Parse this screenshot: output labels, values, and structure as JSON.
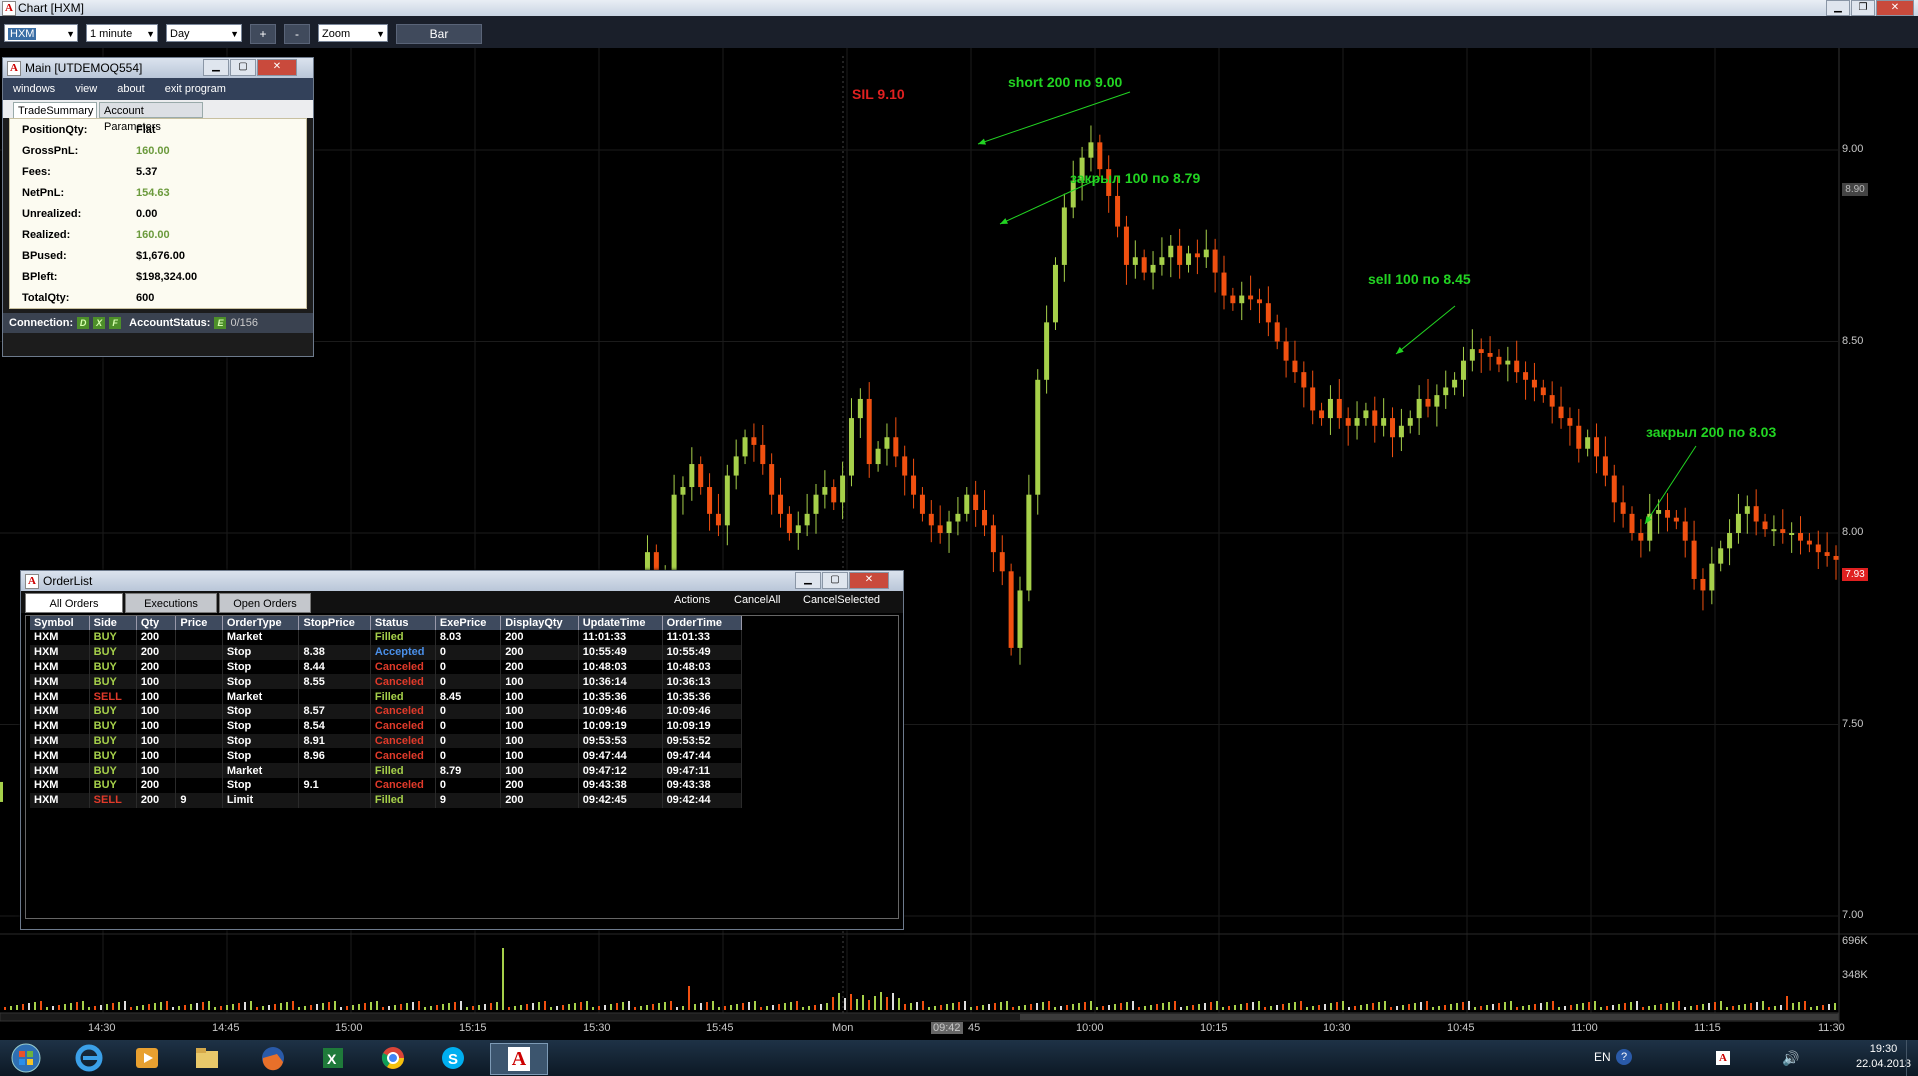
{
  "window": {
    "title": "Chart [HXM]"
  },
  "toolbar": {
    "symbol": "HXM",
    "interval": "1 minute",
    "period": "Day",
    "plus": "+",
    "minus": "-",
    "zoom": "Zoom",
    "style": "Bar"
  },
  "annotations": {
    "sl": "SIL 9.10",
    "short": "short 200  по 9.00",
    "close1": "закрыл 100 по 8.79",
    "sell": "sell 100 по 8.45",
    "close2": "закрыл 200 по 8.03"
  },
  "chart_data": {
    "type": "candlestick",
    "price_ticks": [
      "9.00",
      "8.50",
      "8.00",
      "7.50",
      "7.00"
    ],
    "volume_ticks": [
      "696K",
      "348K"
    ],
    "current_price_tags": [
      "8.90",
      "7.93"
    ],
    "time_labels": [
      "14:30",
      "14:45",
      "15:00",
      "15:15",
      "15:30",
      "15:45",
      "Mon",
      "09:42",
      "45",
      "10:00",
      "10:15",
      "10:30",
      "10:45",
      "11:00",
      "11:15",
      "11:30"
    ],
    "ylim": [
      6.98,
      9.3
    ],
    "close_path": [
      7.35,
      7.3,
      7.55,
      7.8,
      7.95,
      7.75,
      7.88,
      8.1,
      8.12,
      8.18,
      8.12,
      8.05,
      8.02,
      8.15,
      8.2,
      8.25,
      8.23,
      8.18,
      8.1,
      8.05,
      8.0,
      8.02,
      8.05,
      8.1,
      8.12,
      8.08,
      8.15,
      8.3,
      8.35,
      8.18,
      8.22,
      8.25,
      8.2,
      8.15,
      8.1,
      8.05,
      8.02,
      8.0,
      8.03,
      8.05,
      8.1,
      8.06,
      8.02,
      7.95,
      7.9,
      7.7,
      7.85,
      8.1,
      8.4,
      8.55,
      8.7,
      8.85,
      8.92,
      8.98,
      9.02,
      8.95,
      8.88,
      8.8,
      8.7,
      8.72,
      8.68,
      8.7,
      8.72,
      8.75,
      8.7,
      8.73,
      8.72,
      8.74,
      8.68,
      8.62,
      8.6,
      8.62,
      8.61,
      8.6,
      8.55,
      8.5,
      8.45,
      8.42,
      8.38,
      8.32,
      8.3,
      8.35,
      8.3,
      8.28,
      8.3,
      8.32,
      8.28,
      8.3,
      8.25,
      8.28,
      8.3,
      8.35,
      8.33,
      8.36,
      8.38,
      8.4,
      8.45,
      8.48,
      8.47,
      8.46,
      8.44,
      8.45,
      8.42,
      8.4,
      8.38,
      8.36,
      8.33,
      8.3,
      8.28,
      8.22,
      8.25,
      8.2,
      8.15,
      8.08,
      8.05,
      8.0,
      7.98,
      8.05,
      8.06,
      8.04,
      8.03,
      7.98,
      7.88,
      7.85,
      7.92,
      7.96,
      8.0,
      8.05,
      8.07,
      8.03,
      8.01,
      8.01,
      8.0,
      8.0,
      7.98,
      7.97,
      7.95,
      7.94,
      7.93
    ]
  },
  "main_window": {
    "title": "Main [UTDEMOQ554]",
    "menu": [
      "windows",
      "view",
      "about",
      "exit program"
    ],
    "tabs": [
      "TradeSummary",
      "Account Parameters"
    ],
    "summary": [
      {
        "k": "PositionQty:",
        "v": "Flat"
      },
      {
        "k": "GrossPnL:",
        "v": "160.00"
      },
      {
        "k": "Fees:",
        "v": "5.37"
      },
      {
        "k": "NetPnL:",
        "v": "154.63"
      },
      {
        "k": "Unrealized:",
        "v": "0.00"
      },
      {
        "k": "Realized:",
        "v": "160.00"
      },
      {
        "k": "BPused:",
        "v": "$1,676.00"
      },
      {
        "k": "BPleft:",
        "v": "$198,324.00"
      },
      {
        "k": "TotalQty:",
        "v": "600"
      }
    ],
    "status": {
      "connection": "Connection:",
      "d": "D",
      "x": "X",
      "f": "F",
      "account": "AccountStatus:",
      "e": "E",
      "count": "0/156"
    }
  },
  "orders_window": {
    "title": "OrderList",
    "tabs": [
      "All Orders",
      "Executions",
      "Open Orders"
    ],
    "actions": [
      "Actions",
      "CancelAll",
      "CancelSelected"
    ],
    "columns": [
      "Symbol",
      "Side",
      "Qty",
      "Price",
      "OrderType",
      "StopPrice",
      "Status",
      "ExePrice",
      "DisplayQty",
      "UpdateTime",
      "OrderTime"
    ],
    "rows": [
      [
        "HXM",
        "BUY",
        "200",
        "",
        "Market",
        "",
        "Filled",
        "8.03",
        "200",
        "11:01:33",
        "11:01:33"
      ],
      [
        "HXM",
        "BUY",
        "200",
        "",
        "Stop",
        "8.38",
        "Accepted",
        "0",
        "200",
        "10:55:49",
        "10:55:49"
      ],
      [
        "HXM",
        "BUY",
        "200",
        "",
        "Stop",
        "8.44",
        "Canceled",
        "0",
        "200",
        "10:48:03",
        "10:48:03"
      ],
      [
        "HXM",
        "BUY",
        "100",
        "",
        "Stop",
        "8.55",
        "Canceled",
        "0",
        "100",
        "10:36:14",
        "10:36:13"
      ],
      [
        "HXM",
        "SELL",
        "100",
        "",
        "Market",
        "",
        "Filled",
        "8.45",
        "100",
        "10:35:36",
        "10:35:36"
      ],
      [
        "HXM",
        "BUY",
        "100",
        "",
        "Stop",
        "8.57",
        "Canceled",
        "0",
        "100",
        "10:09:46",
        "10:09:46"
      ],
      [
        "HXM",
        "BUY",
        "100",
        "",
        "Stop",
        "8.54",
        "Canceled",
        "0",
        "100",
        "10:09:19",
        "10:09:19"
      ],
      [
        "HXM",
        "BUY",
        "100",
        "",
        "Stop",
        "8.91",
        "Canceled",
        "0",
        "100",
        "09:53:53",
        "09:53:52"
      ],
      [
        "HXM",
        "BUY",
        "100",
        "",
        "Stop",
        "8.96",
        "Canceled",
        "0",
        "100",
        "09:47:44",
        "09:47:44"
      ],
      [
        "HXM",
        "BUY",
        "100",
        "",
        "Market",
        "",
        "Filled",
        "8.79",
        "100",
        "09:47:12",
        "09:47:11"
      ],
      [
        "HXM",
        "BUY",
        "200",
        "",
        "Stop",
        "9.1",
        "Canceled",
        "0",
        "200",
        "09:43:38",
        "09:43:38"
      ],
      [
        "HXM",
        "SELL",
        "200",
        "9",
        "Limit",
        "",
        "Filled",
        "9",
        "200",
        "09:42:45",
        "09:42:44"
      ]
    ]
  },
  "taskbar": {
    "lang": "EN",
    "time": "19:30",
    "date": "22.04.2013"
  },
  "colors": {
    "up": "#a6d04a",
    "down": "#f05010",
    "annotation": "#22d422"
  }
}
